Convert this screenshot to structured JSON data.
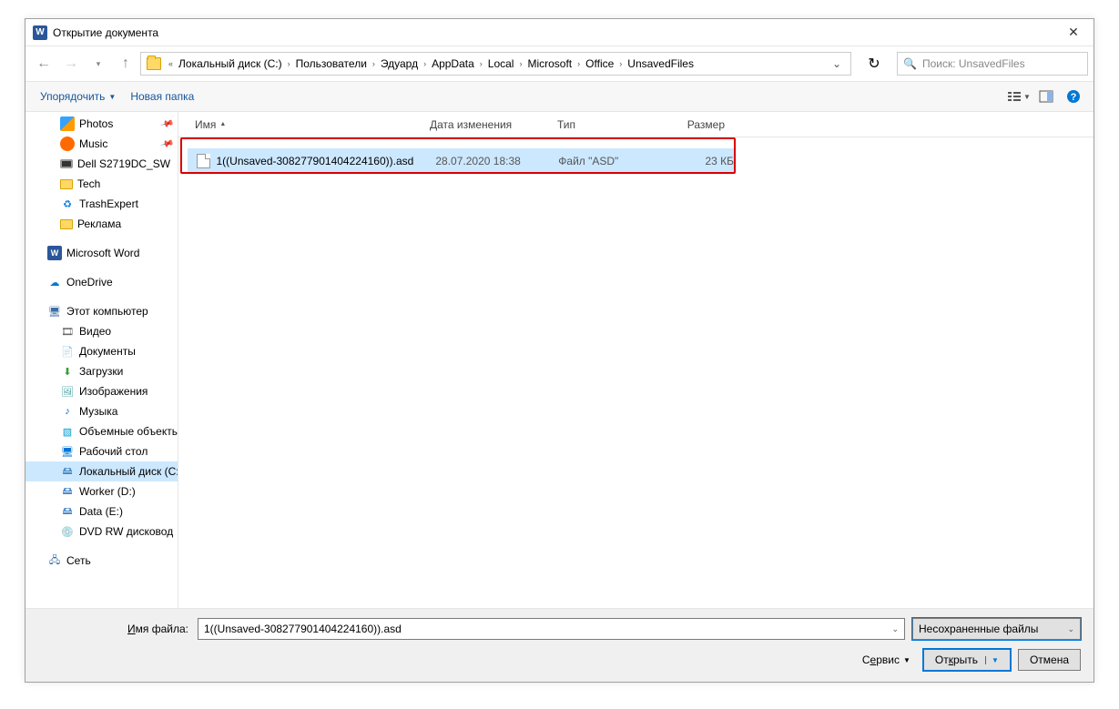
{
  "title": "Открытие документа",
  "breadcrumbs": [
    "Локальный диск (C:)",
    "Пользователи",
    "Эдуард",
    "AppData",
    "Local",
    "Microsoft",
    "Office",
    "UnsavedFiles"
  ],
  "search_placeholder": "Поиск: UnsavedFiles",
  "cmdbar": {
    "organize": "Упорядочить",
    "newfolder": "Новая папка"
  },
  "columns": {
    "name": "Имя",
    "modified": "Дата изменения",
    "type": "Тип",
    "size": "Размер"
  },
  "sidebar": {
    "quick": [
      {
        "label": "Photos",
        "icon": "i-photos",
        "pin": true
      },
      {
        "label": "Music",
        "icon": "i-music",
        "pin": true
      },
      {
        "label": "Dell S2719DC_SW",
        "icon": "i-monitor"
      },
      {
        "label": "Tech",
        "icon": "i-folder"
      },
      {
        "label": "TrashExpert",
        "icon": "i-trash",
        "glyph": "♻"
      },
      {
        "label": "Реклама",
        "icon": "i-folder"
      }
    ],
    "word": "Microsoft Word",
    "onedrive": "OneDrive",
    "pc": "Этот компьютер",
    "pcitems": [
      {
        "label": "Видео",
        "glyph": "🎞",
        "icon": "i-video"
      },
      {
        "label": "Документы",
        "glyph": "📄",
        "icon": "i-docs"
      },
      {
        "label": "Загрузки",
        "glyph": "⬇",
        "icon": "i-dl"
      },
      {
        "label": "Изображения",
        "glyph": "🖼",
        "icon": "i-img"
      },
      {
        "label": "Музыка",
        "glyph": "♪",
        "icon": "i-musicn"
      },
      {
        "label": "Объемные объекты",
        "glyph": "▧",
        "icon": "i-3d"
      },
      {
        "label": "Рабочий стол",
        "glyph": "🖥",
        "icon": "i-desk"
      },
      {
        "label": "Локальный диск (C:)",
        "glyph": "🖴",
        "icon": "i-disk",
        "sel": true
      },
      {
        "label": "Worker (D:)",
        "glyph": "🖴",
        "icon": "i-disk"
      },
      {
        "label": "Data (E:)",
        "glyph": "🖴",
        "icon": "i-disk"
      },
      {
        "label": "DVD RW дисковод",
        "glyph": "💿",
        "icon": "i-dvd"
      }
    ],
    "network": "Сеть"
  },
  "file": {
    "name": "1((Unsaved-308277901404224160)).asd",
    "modified": "28.07.2020 18:38",
    "type": "Файл \"ASD\"",
    "size": "23 КБ"
  },
  "footer": {
    "filename_label": "Имя файла:",
    "filename_value": "1((Unsaved-308277901404224160)).asd",
    "filter": "Несохраненные файлы",
    "service": "Сервис",
    "open": "Открыть",
    "cancel": "Отмена"
  }
}
